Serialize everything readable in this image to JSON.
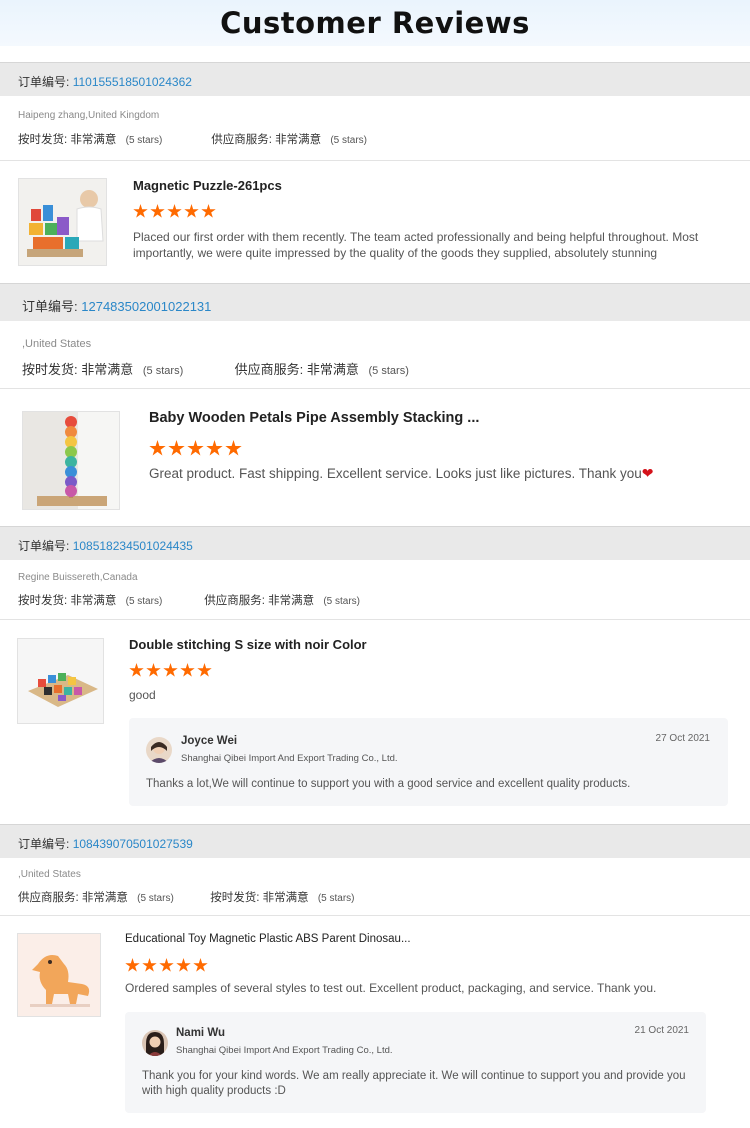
{
  "header": {
    "title": "Customer Reviews"
  },
  "reviews": [
    {
      "order_label": "订单编号:",
      "order_number": "110155518501024362",
      "buyer": "Haipeng zhang,United Kingdom",
      "rating1_label": "按时发货:",
      "rating1_value": "非常满意",
      "rating1_stars": "(5 stars)",
      "rating2_label": "供应商服务:",
      "rating2_value": "非常满意",
      "rating2_stars": "(5 stars)",
      "product_title": "Magnetic Puzzle-261pcs",
      "stars": 5,
      "text": "Placed our first order with them recently. The team acted professionally and being helpful throughout. Most importantly, we were quite impressed by the quality of the goods they supplied, absolutely stunning"
    },
    {
      "order_label": "订单编号:",
      "order_number": "127483502001022131",
      "buyer": ",United States",
      "rating1_label": "按时发货:",
      "rating1_value": "非常满意",
      "rating1_stars": "(5 stars)",
      "rating2_label": "供应商服务:",
      "rating2_value": "非常满意",
      "rating2_stars": "(5 stars)",
      "product_title": "Baby Wooden Petals Pipe Assembly Stacking ...",
      "stars": 5,
      "text": "Great product. Fast shipping. Excellent service. Looks just like pictures. Thank you"
    },
    {
      "order_label": "订单编号:",
      "order_number": "108518234501024435",
      "buyer": "Regine Buissereth,Canada",
      "rating1_label": "按时发货:",
      "rating1_value": "非常满意",
      "rating1_stars": "(5 stars)",
      "rating2_label": "供应商服务:",
      "rating2_value": "非常满意",
      "rating2_stars": "(5 stars)",
      "product_title": "Double stitching S size with noir Color",
      "stars": 5,
      "text": "good",
      "reply": {
        "name": "Joyce Wei",
        "company": "Shanghai Qibei Import And Export Trading Co., Ltd.",
        "date": "27 Oct 2021",
        "message": "Thanks a lot,We will continue to support you with a good service and excellent quality products."
      }
    },
    {
      "order_label": "订单编号:",
      "order_number": "108439070501027539",
      "buyer": ",United States",
      "rating1_label": "供应商服务:",
      "rating1_value": "非常满意",
      "rating1_stars": "(5 stars)",
      "rating2_label": "按时发货:",
      "rating2_value": "非常满意",
      "rating2_stars": "(5 stars)",
      "product_title": "Educational Toy Magnetic Plastic ABS Parent Dinosau...",
      "stars": 5,
      "text": "Ordered samples of several styles to test out. Excellent product, packaging, and service. Thank you.",
      "reply": {
        "name": "Nami Wu",
        "company": "Shanghai Qibei Import And Export Trading Co., Ltd.",
        "date": "21 Oct 2021",
        "message": "Thank you for your kind words. We am really appreciate it. We will continue to support you and provide you with high quality products :D"
      }
    }
  ]
}
